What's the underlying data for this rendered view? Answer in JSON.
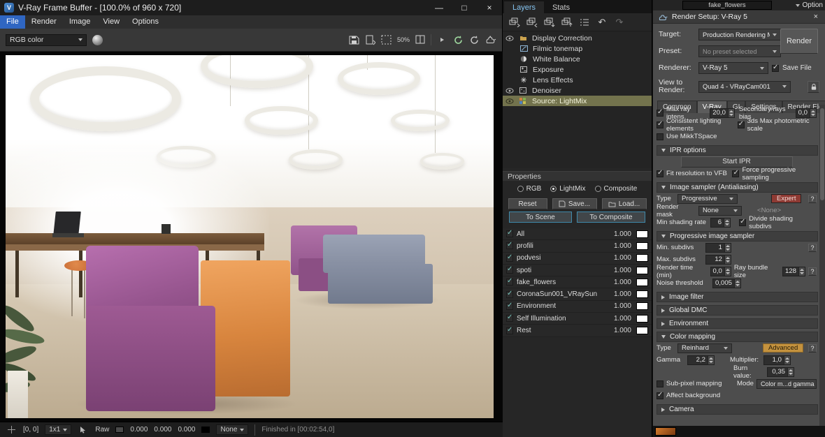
{
  "colors": {
    "accent_blue": "#2f66c2",
    "selection_khaki": "#73734d",
    "expert_red": "#8e3a33",
    "advanced_orange": "#c4923e",
    "swatch_white": "#ffffff"
  },
  "icons": {
    "minimize": "—",
    "maximize": "□",
    "close": "×",
    "res_toggle": "50%",
    "undo": "↶",
    "redo": "↷"
  },
  "vfb": {
    "title": "V-Ray Frame Buffer - [100.0% of 960 x 720]",
    "menus": [
      "File",
      "Render",
      "Image",
      "View",
      "Options"
    ],
    "channel": "RGB color",
    "status": {
      "coords": "[0, 0]",
      "pixel": "1x1",
      "raw": "Raw",
      "v1": "0.000",
      "v2": "0.000",
      "v3": "0.000",
      "none": "None",
      "finished": "Finished in [00:02:54,0]"
    }
  },
  "panel": {
    "tabs": {
      "layers": "Layers",
      "stats": "Stats"
    },
    "tree": [
      {
        "label": "Display Correction"
      },
      {
        "label": "Filmic tonemap"
      },
      {
        "label": "White Balance"
      },
      {
        "label": "Exposure"
      },
      {
        "label": "Lens Effects"
      },
      {
        "label": "Denoiser"
      },
      {
        "label": "Source: LightMix"
      }
    ],
    "properties_title": "Properties",
    "modes": {
      "rgb": "RGB",
      "lightmix": "LightMix",
      "composite": "Composite"
    },
    "buttons": {
      "reset": "Reset",
      "save": "Save...",
      "load": "Load...",
      "to_scene": "To Scene",
      "to_composite": "To Composite"
    },
    "rows": [
      {
        "label": "All",
        "value": "1.000"
      },
      {
        "label": "profili",
        "value": "1.000"
      },
      {
        "label": "podvesi",
        "value": "1.000"
      },
      {
        "label": "spoti",
        "value": "1.000"
      },
      {
        "label": "fake_flowers",
        "value": "1.000"
      },
      {
        "label": "CoronaSun001_VRaySun",
        "value": "1.000"
      },
      {
        "label": "Environment",
        "value": "1.000"
      },
      {
        "label": "Self Illumination",
        "value": "1.000"
      },
      {
        "label": "Rest",
        "value": "1.000"
      }
    ]
  },
  "setup": {
    "overlay_field": "fake_flowers",
    "option": "Option",
    "title": "Render Setup: V-Ray 5",
    "target_label": "Target:",
    "target_value": "Production Rendering Mode",
    "render": "Render",
    "preset_label": "Preset:",
    "preset_value": "No preset selected",
    "renderer_label": "Renderer:",
    "renderer_value": "V-Ray 5",
    "save_file": "Save File",
    "view_label": "View to Render:",
    "view_value": "Quad 4 - VRayCam001",
    "tabs": [
      "Common",
      "V-Ray",
      "GI",
      "Settings",
      "Render Elements"
    ],
    "vray": {
      "qmark": "?",
      "max_ray_label": "Max ray intens.",
      "max_ray_value": "20,0",
      "sec_bias_label": "Secondary rays bias",
      "sec_bias_value": "0,0",
      "consistent": "Consistent lighting elements",
      "photometric": "3ds Max photometric scale",
      "mikkt": "Use MikkTSpace",
      "ipr_title": "IPR options",
      "start_ipr": "Start IPR",
      "fit_res": "Fit resolution to VFB",
      "force_prog": "Force progressive sampling",
      "sampler_title": "Image sampler (Antialiasing)",
      "type_label": "Type",
      "sampler_type": "Progressive",
      "expert": "Expert",
      "render_mask_label": "Render mask",
      "render_mask_value": "None",
      "render_mask_none": "<None>",
      "min_shading_label": "Min shading rate",
      "min_shading_value": "6",
      "divide_shading": "Divide shading subdivs",
      "prog_title": "Progressive image sampler",
      "min_subdivs_label": "Min. subdivs",
      "min_subdivs_value": "1",
      "max_subdivs_label": "Max. subdivs",
      "max_subdivs_value": "12",
      "render_time_label": "Render time (min)",
      "render_time_value": "0,0",
      "ray_bundle_label": "Ray bundle size",
      "ray_bundle_value": "128",
      "noise_label": "Noise threshold",
      "noise_value": "0,005",
      "image_filter_title": "Image filter",
      "global_dmc_title": "Global DMC",
      "environment_title": "Environment",
      "color_mapping_title": "Color mapping",
      "cm_type_label": "Type",
      "cm_type_value": "Reinhard",
      "advanced": "Advanced",
      "gamma_label": "Gamma",
      "gamma_value": "2,2",
      "multiplier_label": "Multiplier:",
      "multiplier_value": "1,0",
      "burn_label": "Burn value:",
      "burn_value": "0,35",
      "subpixel": "Sub-pixel mapping",
      "affect_bg": "Affect background",
      "mode_label": "Mode",
      "mode_value": "Color m...d gamma",
      "camera_title": "Camera"
    }
  }
}
